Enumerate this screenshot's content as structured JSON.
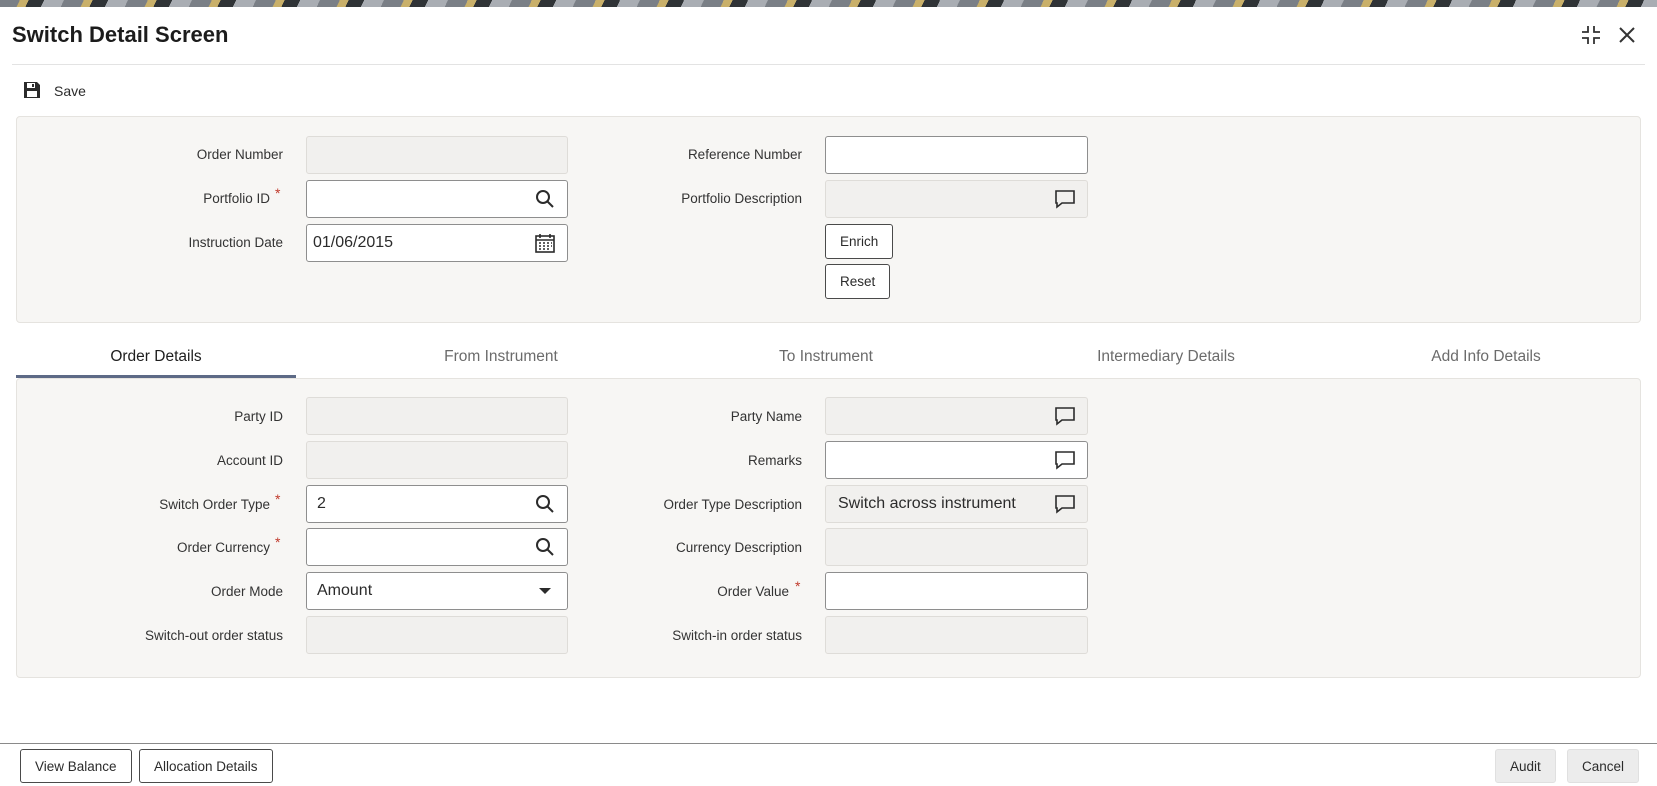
{
  "header": {
    "title": "Switch Detail Screen"
  },
  "toolbar": {
    "save_label": "Save"
  },
  "top_form": {
    "order_number": {
      "label": "Order Number",
      "value": ""
    },
    "portfolio_id": {
      "label": "Portfolio ID",
      "value": ""
    },
    "instruction_date": {
      "label": "Instruction Date",
      "value": "01/06/2015"
    },
    "reference_number": {
      "label": "Reference Number",
      "value": ""
    },
    "portfolio_description": {
      "label": "Portfolio Description",
      "value": ""
    },
    "enrich_label": "Enrich",
    "reset_label": "Reset"
  },
  "required_mark": "*",
  "tabs": [
    {
      "label": "Order Details"
    },
    {
      "label": "From Instrument"
    },
    {
      "label": "To Instrument"
    },
    {
      "label": "Intermediary Details"
    },
    {
      "label": "Add Info Details"
    }
  ],
  "order_details": {
    "party_id": {
      "label": "Party ID",
      "value": ""
    },
    "account_id": {
      "label": "Account ID",
      "value": ""
    },
    "switch_order_type": {
      "label": "Switch Order Type",
      "value": "2"
    },
    "order_currency": {
      "label": "Order Currency",
      "value": ""
    },
    "order_mode": {
      "label": "Order Mode",
      "value": "Amount"
    },
    "switch_out_status": {
      "label": "Switch-out order status",
      "value": ""
    },
    "party_name": {
      "label": "Party Name",
      "value": ""
    },
    "remarks": {
      "label": "Remarks",
      "value": ""
    },
    "order_type_description": {
      "label": "Order Type Description",
      "value": "Switch across instrument"
    },
    "currency_description": {
      "label": "Currency Description",
      "value": ""
    },
    "order_value": {
      "label": "Order Value",
      "value": ""
    },
    "switch_in_status": {
      "label": "Switch-in order status",
      "value": ""
    }
  },
  "footer": {
    "view_balance_label": "View Balance",
    "allocation_details_label": "Allocation Details",
    "audit_label": "Audit",
    "cancel_label": "Cancel"
  },
  "colors": {
    "required": "#c0392b",
    "active_tab": "#5d6a86",
    "panel_bg": "#f7f6f4"
  },
  "icons": [
    "save-icon",
    "maximize-icon",
    "close-icon",
    "search-icon",
    "calendar-icon",
    "comment-icon",
    "caret-down-icon"
  ]
}
